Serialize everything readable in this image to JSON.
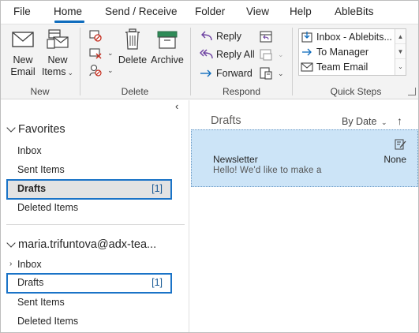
{
  "tabs": {
    "file": "File",
    "home": "Home",
    "send_receive": "Send / Receive",
    "folder": "Folder",
    "view": "View",
    "help": "Help",
    "ablebits": "AbleBits",
    "active": "Home"
  },
  "ribbon": {
    "new_group": {
      "label": "New",
      "new_email": "New\nEmail",
      "new_email_line1": "New",
      "new_email_line2": "Email",
      "new_items_line1": "New",
      "new_items_line2": "Items"
    },
    "delete_group": {
      "label": "Delete",
      "delete": "Delete",
      "archive": "Archive"
    },
    "respond_group": {
      "label": "Respond",
      "reply": "Reply",
      "reply_all": "Reply All",
      "forward": "Forward"
    },
    "quick_steps_group": {
      "label": "Quick Steps",
      "items": [
        "Inbox - Ablebits...",
        "To Manager",
        "Team Email"
      ]
    }
  },
  "folders": {
    "collapse_glyph": "‹",
    "favorites": {
      "title": "Favorites",
      "items": [
        {
          "label": "Inbox",
          "count": ""
        },
        {
          "label": "Sent Items",
          "count": ""
        },
        {
          "label": "Drafts",
          "count": "[1]"
        },
        {
          "label": "Deleted Items",
          "count": ""
        }
      ]
    },
    "account": {
      "title": "maria.trifuntova@adx-tea...",
      "items": [
        {
          "label": "Inbox",
          "count": ""
        },
        {
          "label": "Drafts",
          "count": "[1]"
        },
        {
          "label": "Sent Items",
          "count": ""
        },
        {
          "label": "Deleted Items",
          "count": ""
        }
      ]
    }
  },
  "message_list": {
    "folder_title": "Drafts",
    "sort_label": "By Date",
    "messages": [
      {
        "sender": "Newsletter",
        "preview": "Hello!  We'd like to make a",
        "date": "None"
      }
    ]
  },
  "colors": {
    "accent": "#0f6cbd",
    "selection_border": "#1a73c7",
    "message_selected_bg": "#cce4f7",
    "ribbon_bg": "#f3f3f3"
  }
}
